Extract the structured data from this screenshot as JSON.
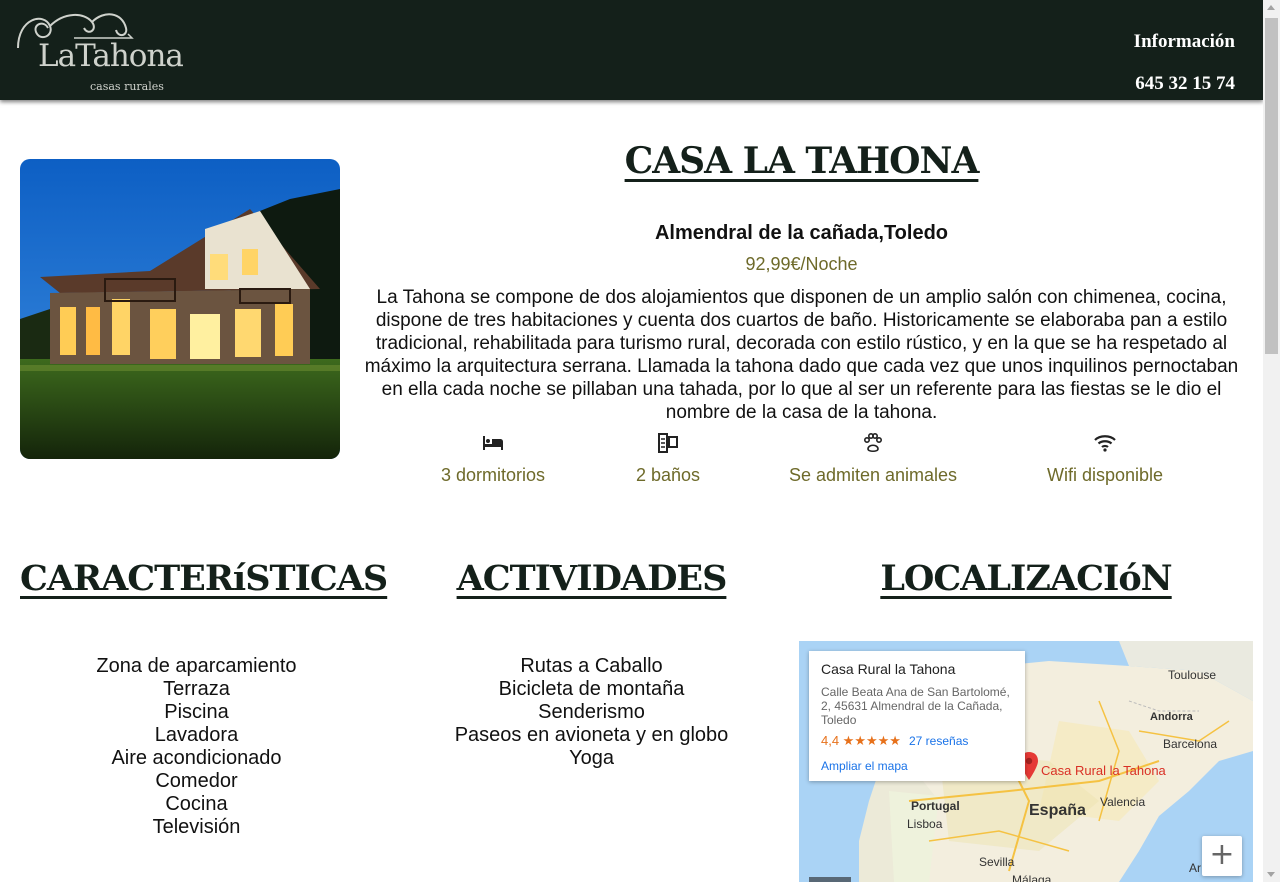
{
  "header": {
    "logo_main": "LaTahona",
    "logo_sub": "casas rurales",
    "nav_info": "Información",
    "phone": "645 32 15 74"
  },
  "property": {
    "title": "CASA LA TAHONA",
    "location": "Almendral de la cañada,Toledo",
    "price": "92,99€/Noche",
    "description": "La Tahona se compone de dos alojamientos que disponen de un amplio salón con chimenea, cocina, dispone de tres habitaciones y cuenta dos cuartos de baño. Historicamente se elaboraba pan a estilo tradicional, rehabilitada para turismo rural, decorada con estilo rústico, y en la que se ha respetado al máximo la arquitectura serrana. Llamada la tahona dado que cada vez que unos inquilinos pernoctaban en ella cada noche se pillaban una tahada, por lo que al ser un referente para las fiestas se le dio el nombre de la casa de la tahona.",
    "features": [
      {
        "icon": "bed-icon",
        "label": "3 dormitorios"
      },
      {
        "icon": "shower-icon",
        "label": "2 baños"
      },
      {
        "icon": "paw-icon",
        "label": "Se admiten animales"
      },
      {
        "icon": "wifi-icon",
        "label": "Wifi disponible"
      }
    ]
  },
  "sections": {
    "caracteristicas": {
      "title": "CARACTERíSTICAS",
      "items": [
        "Zona de aparcamiento",
        "Terraza",
        "Piscina",
        "Lavadora",
        "Aire acondicionado",
        "Comedor",
        "Cocina",
        "Televisión"
      ]
    },
    "actividades": {
      "title": "ACTIVIDADES",
      "items": [
        "Rutas a Caballo",
        "Bicicleta de montaña",
        "Senderismo",
        "Paseos en avioneta y en globo",
        "Yoga"
      ]
    },
    "localizacion": {
      "title": "LOCALIZACIóN"
    }
  },
  "map": {
    "place_name": "Casa Rural la Tahona",
    "address": "Calle Beata Ana de San Bartolomé, 2, 45631 Almendral de la Cañada, Toledo",
    "rating": "4,4 ★★★★★",
    "reviews": "27 reseñas",
    "enlarge": "Ampliar el mapa",
    "pin_label": "Casa Rural la Tahona",
    "zoom_in": "+",
    "labels": {
      "toulouse": "Toulouse",
      "andorra": "Andorra",
      "barcelona": "Barcelona",
      "portugal": "Portugal",
      "lisboa": "Lisboa",
      "espana": "España",
      "valencia": "Valencia",
      "sevilla": "Sevilla",
      "malaga": "Málaga",
      "ar": "Ar"
    }
  },
  "colors": {
    "header_bg": "#14201a",
    "accent_olive": "#6e6a2a",
    "map_pin": "#e53935"
  }
}
